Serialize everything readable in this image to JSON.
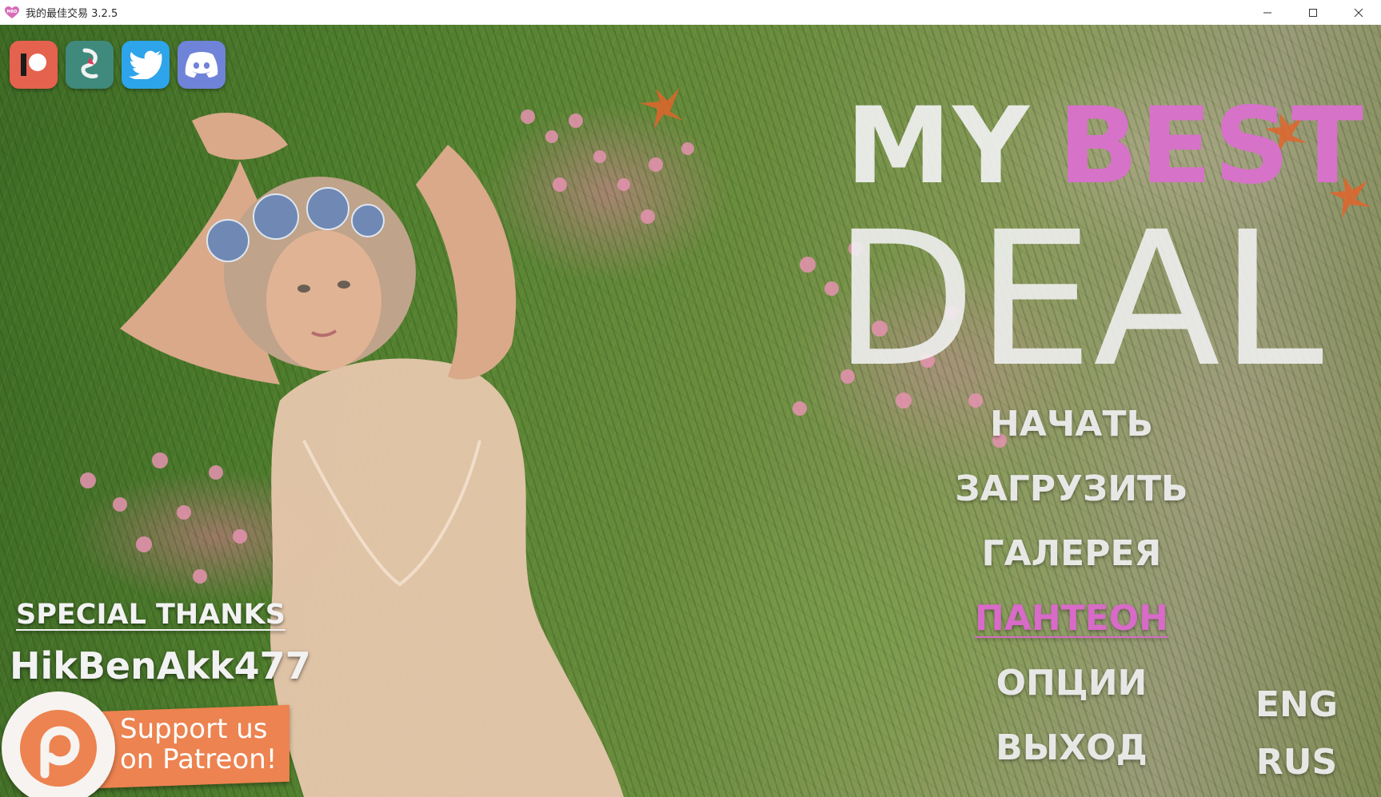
{
  "window": {
    "title": "我的最佳交易 3.2.5",
    "controls": [
      "minimize",
      "maximize",
      "close"
    ]
  },
  "social": [
    {
      "name": "patreon",
      "icon": "patreon-icon",
      "color": "#e4624e"
    },
    {
      "name": "subscribestar",
      "icon": "subscribestar-icon",
      "color": "#3f8a7c"
    },
    {
      "name": "twitter",
      "icon": "twitter-bird-icon",
      "color": "#2ea4ea"
    },
    {
      "name": "discord",
      "icon": "discord-icon",
      "color": "#6f83d8"
    }
  ],
  "logo": {
    "word_my": "MY",
    "word_best": "BEST",
    "word_deal": "DEAL",
    "accent_color": "#d672c8"
  },
  "menu": {
    "items": [
      {
        "label": "НАЧАТЬ",
        "active": false
      },
      {
        "label": "ЗАГРУЗИТЬ",
        "active": false
      },
      {
        "label": "ГАЛЕРЕЯ",
        "active": false
      },
      {
        "label": "ПАНТЕОН",
        "active": true
      },
      {
        "label": "ОПЦИИ",
        "active": false
      },
      {
        "label": "ВЫХОД",
        "active": false
      }
    ]
  },
  "language": {
    "options": [
      "ENG",
      "RUS"
    ]
  },
  "thanks": {
    "title": "SPECIAL THANKS",
    "name": "HikBenAkk477"
  },
  "patreon_banner": {
    "line1": "Support us",
    "line2": "on Patreon!",
    "color": "#ec8350"
  }
}
